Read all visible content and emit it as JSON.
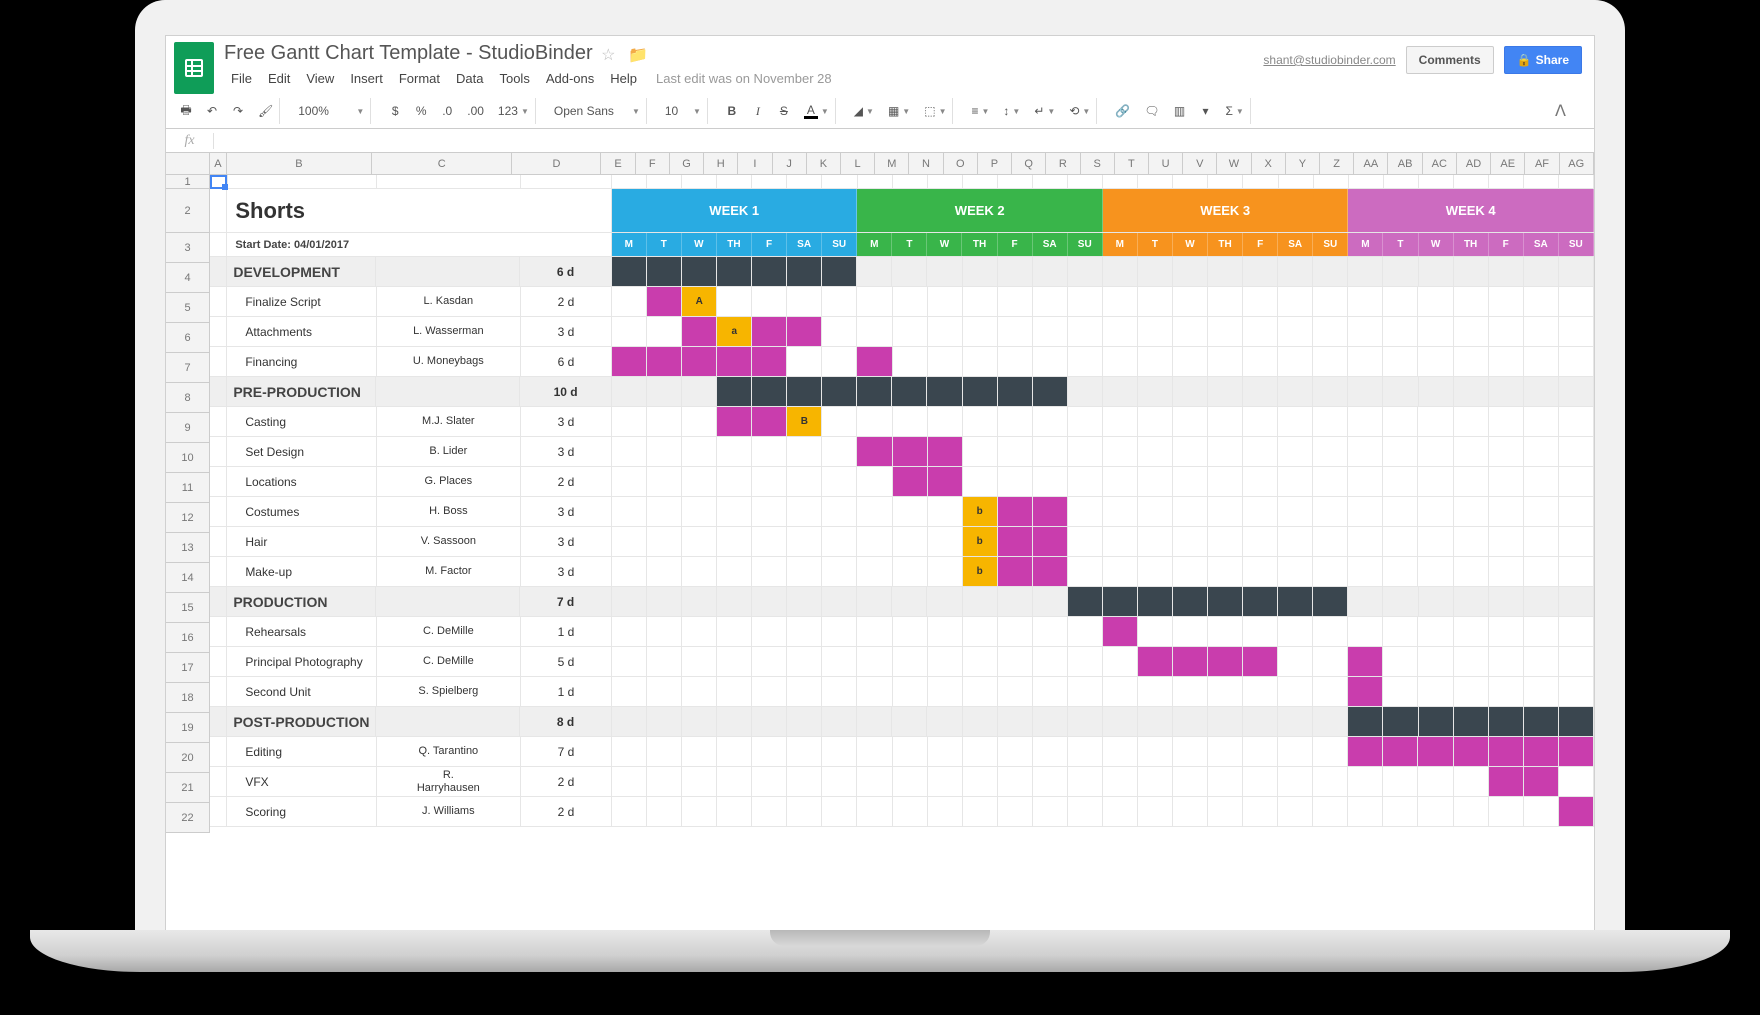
{
  "header": {
    "doc_title": "Free Gantt Chart Template - StudioBinder",
    "user_email": "shant@studiobinder.com",
    "comments_label": "Comments",
    "share_label": "Share",
    "edit_status": "Last edit was on November 28"
  },
  "menu": [
    "File",
    "Edit",
    "View",
    "Insert",
    "Format",
    "Data",
    "Tools",
    "Add-ons",
    "Help"
  ],
  "toolbar": {
    "zoom": "100%",
    "currency": "$",
    "percent": "%",
    "dec_dec": ".0←",
    "inc_dec": ".00→",
    "more_fmt": "123",
    "font": "Open Sans",
    "font_size": "10"
  },
  "fx_label": "fx",
  "columns_left": [
    "A",
    "B",
    "C",
    "D"
  ],
  "columns_days": [
    "E",
    "F",
    "G",
    "H",
    "I",
    "J",
    "K",
    "L",
    "M",
    "N",
    "O",
    "P",
    "Q",
    "R",
    "S",
    "T",
    "U",
    "V",
    "W",
    "X",
    "Y",
    "Z",
    "AA",
    "AB",
    "AC",
    "AD",
    "AE",
    "AF",
    "AG"
  ],
  "row_numbers": [
    1,
    2,
    3,
    4,
    5,
    6,
    7,
    8,
    9,
    10,
    11,
    12,
    13,
    14,
    15,
    16,
    17,
    18,
    19,
    20,
    21,
    22
  ],
  "sheet": {
    "title": "Shorts",
    "start_date_label": "Start Date: 04/01/2017",
    "weeks": [
      {
        "label": "WEEK 1",
        "cls": "w1"
      },
      {
        "label": "WEEK 2",
        "cls": "w2"
      },
      {
        "label": "WEEK 3",
        "cls": "w3"
      },
      {
        "label": "WEEK 4",
        "cls": "w4"
      }
    ],
    "day_abbrev": [
      "M",
      "T",
      "W",
      "TH",
      "F",
      "SA",
      "SU"
    ]
  },
  "rows": [
    {
      "type": "section",
      "name": "DEVELOPMENT",
      "dur": "6 d",
      "bar_start": 0,
      "bar_len": 7,
      "bar_cls": "bar-dark"
    },
    {
      "type": "task",
      "name": "Finalize Script",
      "who": "L. Kasdan",
      "dur": "2 d",
      "cells": [
        {
          "i": 1,
          "cls": "bar-pink"
        },
        {
          "i": 2,
          "cls": "bar-yellow",
          "t": "A"
        }
      ]
    },
    {
      "type": "task",
      "name": "Attachments",
      "who": "L. Wasserman",
      "dur": "3 d",
      "cells": [
        {
          "i": 2,
          "cls": "bar-pink"
        },
        {
          "i": 3,
          "cls": "bar-yellow",
          "t": "a"
        },
        {
          "i": 4,
          "cls": "bar-pink"
        },
        {
          "i": 5,
          "cls": "bar-pink"
        }
      ]
    },
    {
      "type": "task",
      "name": "Financing",
      "who": "U. Moneybags",
      "dur": "6 d",
      "cells": [
        {
          "i": 0,
          "cls": "bar-pink"
        },
        {
          "i": 1,
          "cls": "bar-pink"
        },
        {
          "i": 2,
          "cls": "bar-pink"
        },
        {
          "i": 3,
          "cls": "bar-pink"
        },
        {
          "i": 4,
          "cls": "bar-pink"
        },
        {
          "i": 7,
          "cls": "bar-pink"
        }
      ]
    },
    {
      "type": "section",
      "name": "PRE-PRODUCTION",
      "dur": "10 d",
      "bar_start": 3,
      "bar_len": 10,
      "bar_cls": "bar-dark"
    },
    {
      "type": "task",
      "name": "Casting",
      "who": "M.J. Slater",
      "dur": "3 d",
      "cells": [
        {
          "i": 3,
          "cls": "bar-pink"
        },
        {
          "i": 4,
          "cls": "bar-pink"
        },
        {
          "i": 5,
          "cls": "bar-yellow",
          "t": "B"
        }
      ]
    },
    {
      "type": "task",
      "name": "Set Design",
      "who": "B. Lider",
      "dur": "3 d",
      "cells": [
        {
          "i": 7,
          "cls": "bar-pink"
        },
        {
          "i": 8,
          "cls": "bar-pink"
        },
        {
          "i": 9,
          "cls": "bar-pink"
        }
      ]
    },
    {
      "type": "task",
      "name": "Locations",
      "who": "G. Places",
      "dur": "2 d",
      "cells": [
        {
          "i": 8,
          "cls": "bar-pink"
        },
        {
          "i": 9,
          "cls": "bar-pink"
        }
      ]
    },
    {
      "type": "task",
      "name": "Costumes",
      "who": "H. Boss",
      "dur": "3 d",
      "cells": [
        {
          "i": 10,
          "cls": "bar-yellow",
          "t": "b"
        },
        {
          "i": 11,
          "cls": "bar-pink"
        },
        {
          "i": 12,
          "cls": "bar-pink"
        }
      ]
    },
    {
      "type": "task",
      "name": "Hair",
      "who": "V. Sassoon",
      "dur": "3 d",
      "cells": [
        {
          "i": 10,
          "cls": "bar-yellow",
          "t": "b"
        },
        {
          "i": 11,
          "cls": "bar-pink"
        },
        {
          "i": 12,
          "cls": "bar-pink"
        }
      ]
    },
    {
      "type": "task",
      "name": "Make-up",
      "who": "M. Factor",
      "dur": "3 d",
      "cells": [
        {
          "i": 10,
          "cls": "bar-yellow",
          "t": "b"
        },
        {
          "i": 11,
          "cls": "bar-pink"
        },
        {
          "i": 12,
          "cls": "bar-pink"
        }
      ]
    },
    {
      "type": "section",
      "name": "PRODUCTION",
      "dur": "7 d",
      "bar_start": 13,
      "bar_len": 8,
      "bar_cls": "bar-dark"
    },
    {
      "type": "task",
      "name": "Rehearsals",
      "who": "C. DeMille",
      "dur": "1 d",
      "cells": [
        {
          "i": 14,
          "cls": "bar-pink"
        }
      ]
    },
    {
      "type": "task",
      "name": "Principal Photography",
      "who": "C. DeMille",
      "dur": "5 d",
      "cells": [
        {
          "i": 15,
          "cls": "bar-pink"
        },
        {
          "i": 16,
          "cls": "bar-pink"
        },
        {
          "i": 17,
          "cls": "bar-pink"
        },
        {
          "i": 18,
          "cls": "bar-pink"
        },
        {
          "i": 21,
          "cls": "bar-pink"
        }
      ]
    },
    {
      "type": "task",
      "name": "Second Unit",
      "who": "S. Spielberg",
      "dur": "1 d",
      "cells": [
        {
          "i": 21,
          "cls": "bar-pink"
        }
      ]
    },
    {
      "type": "section",
      "name": "POST-PRODUCTION",
      "dur": "8 d",
      "bar_start": 21,
      "bar_len": 7,
      "bar_cls": "bar-dark"
    },
    {
      "type": "task",
      "name": "Editing",
      "who": "Q. Tarantino",
      "dur": "7 d",
      "cells": [
        {
          "i": 21,
          "cls": "bar-pink"
        },
        {
          "i": 22,
          "cls": "bar-pink"
        },
        {
          "i": 23,
          "cls": "bar-pink"
        },
        {
          "i": 24,
          "cls": "bar-pink"
        },
        {
          "i": 25,
          "cls": "bar-pink"
        },
        {
          "i": 26,
          "cls": "bar-pink"
        },
        {
          "i": 27,
          "cls": "bar-pink"
        }
      ]
    },
    {
      "type": "task",
      "name": "VFX",
      "who": "R. Harryhausen",
      "dur": "2 d",
      "cells": [
        {
          "i": 25,
          "cls": "bar-pink"
        },
        {
          "i": 26,
          "cls": "bar-pink"
        }
      ]
    },
    {
      "type": "task",
      "name": "Scoring",
      "who": "J. Williams",
      "dur": "2 d",
      "cells": [
        {
          "i": 27,
          "cls": "bar-pink"
        },
        {
          "i": 28,
          "cls": "bar-pink"
        }
      ]
    }
  ],
  "chart_data": {
    "type": "gantt",
    "title": "Shorts",
    "start_date": "04/01/2017",
    "day_columns": 28,
    "weeks": [
      "WEEK 1",
      "WEEK 2",
      "WEEK 3",
      "WEEK 4"
    ],
    "sections": [
      {
        "name": "DEVELOPMENT",
        "duration_days": 6,
        "span": [
          1,
          7
        ],
        "tasks": [
          {
            "name": "Finalize Script",
            "assignee": "L. Kasdan",
            "duration_days": 2,
            "span": [
              2,
              3
            ],
            "milestone": "A"
          },
          {
            "name": "Attachments",
            "assignee": "L. Wasserman",
            "duration_days": 3,
            "span": [
              3,
              6
            ],
            "milestone": "a"
          },
          {
            "name": "Financing",
            "assignee": "U. Moneybags",
            "duration_days": 6,
            "span": [
              1,
              8
            ]
          }
        ]
      },
      {
        "name": "PRE-PRODUCTION",
        "duration_days": 10,
        "span": [
          4,
          13
        ],
        "tasks": [
          {
            "name": "Casting",
            "assignee": "M.J. Slater",
            "duration_days": 3,
            "span": [
              4,
              6
            ],
            "milestone": "B"
          },
          {
            "name": "Set Design",
            "assignee": "B. Lider",
            "duration_days": 3,
            "span": [
              8,
              10
            ]
          },
          {
            "name": "Locations",
            "assignee": "G. Places",
            "duration_days": 2,
            "span": [
              9,
              10
            ]
          },
          {
            "name": "Costumes",
            "assignee": "H. Boss",
            "duration_days": 3,
            "span": [
              11,
              13
            ],
            "milestone": "b"
          },
          {
            "name": "Hair",
            "assignee": "V. Sassoon",
            "duration_days": 3,
            "span": [
              11,
              13
            ],
            "milestone": "b"
          },
          {
            "name": "Make-up",
            "assignee": "M. Factor",
            "duration_days": 3,
            "span": [
              11,
              13
            ],
            "milestone": "b"
          }
        ]
      },
      {
        "name": "PRODUCTION",
        "duration_days": 7,
        "span": [
          14,
          21
        ],
        "tasks": [
          {
            "name": "Rehearsals",
            "assignee": "C. DeMille",
            "duration_days": 1,
            "span": [
              15,
              15
            ]
          },
          {
            "name": "Principal Photography",
            "assignee": "C. DeMille",
            "duration_days": 5,
            "span": [
              16,
              22
            ]
          },
          {
            "name": "Second Unit",
            "assignee": "S. Spielberg",
            "duration_days": 1,
            "span": [
              22,
              22
            ]
          }
        ]
      },
      {
        "name": "POST-PRODUCTION",
        "duration_days": 8,
        "span": [
          22,
          28
        ],
        "tasks": [
          {
            "name": "Editing",
            "assignee": "Q. Tarantino",
            "duration_days": 7,
            "span": [
              22,
              28
            ]
          },
          {
            "name": "VFX",
            "assignee": "R. Harryhausen",
            "duration_days": 2,
            "span": [
              26,
              27
            ]
          },
          {
            "name": "Scoring",
            "assignee": "J. Williams",
            "duration_days": 2,
            "span": [
              28,
              29
            ]
          }
        ]
      }
    ]
  }
}
